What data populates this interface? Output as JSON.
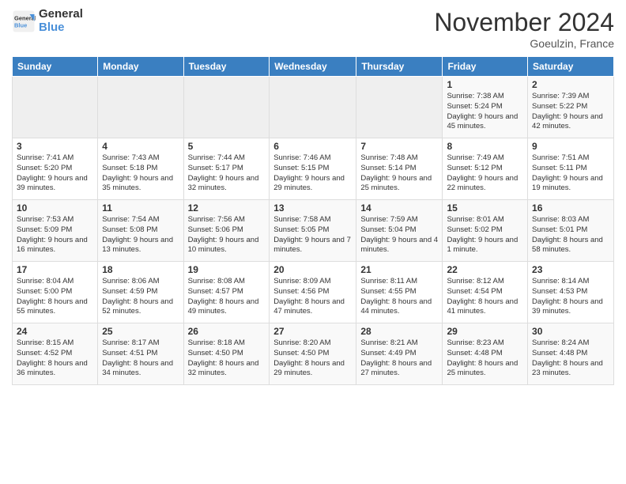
{
  "header": {
    "logo_line1": "General",
    "logo_line2": "Blue",
    "month": "November 2024",
    "location": "Goeulzin, France"
  },
  "days_of_week": [
    "Sunday",
    "Monday",
    "Tuesday",
    "Wednesday",
    "Thursday",
    "Friday",
    "Saturday"
  ],
  "weeks": [
    [
      {
        "day": "",
        "empty": true
      },
      {
        "day": "",
        "empty": true
      },
      {
        "day": "",
        "empty": true
      },
      {
        "day": "",
        "empty": true
      },
      {
        "day": "",
        "empty": true
      },
      {
        "day": "1",
        "sunrise": "Sunrise: 7:38 AM",
        "sunset": "Sunset: 5:24 PM",
        "daylight": "Daylight: 9 hours and 45 minutes."
      },
      {
        "day": "2",
        "sunrise": "Sunrise: 7:39 AM",
        "sunset": "Sunset: 5:22 PM",
        "daylight": "Daylight: 9 hours and 42 minutes."
      }
    ],
    [
      {
        "day": "3",
        "sunrise": "Sunrise: 7:41 AM",
        "sunset": "Sunset: 5:20 PM",
        "daylight": "Daylight: 9 hours and 39 minutes."
      },
      {
        "day": "4",
        "sunrise": "Sunrise: 7:43 AM",
        "sunset": "Sunset: 5:18 PM",
        "daylight": "Daylight: 9 hours and 35 minutes."
      },
      {
        "day": "5",
        "sunrise": "Sunrise: 7:44 AM",
        "sunset": "Sunset: 5:17 PM",
        "daylight": "Daylight: 9 hours and 32 minutes."
      },
      {
        "day": "6",
        "sunrise": "Sunrise: 7:46 AM",
        "sunset": "Sunset: 5:15 PM",
        "daylight": "Daylight: 9 hours and 29 minutes."
      },
      {
        "day": "7",
        "sunrise": "Sunrise: 7:48 AM",
        "sunset": "Sunset: 5:14 PM",
        "daylight": "Daylight: 9 hours and 25 minutes."
      },
      {
        "day": "8",
        "sunrise": "Sunrise: 7:49 AM",
        "sunset": "Sunset: 5:12 PM",
        "daylight": "Daylight: 9 hours and 22 minutes."
      },
      {
        "day": "9",
        "sunrise": "Sunrise: 7:51 AM",
        "sunset": "Sunset: 5:11 PM",
        "daylight": "Daylight: 9 hours and 19 minutes."
      }
    ],
    [
      {
        "day": "10",
        "sunrise": "Sunrise: 7:53 AM",
        "sunset": "Sunset: 5:09 PM",
        "daylight": "Daylight: 9 hours and 16 minutes."
      },
      {
        "day": "11",
        "sunrise": "Sunrise: 7:54 AM",
        "sunset": "Sunset: 5:08 PM",
        "daylight": "Daylight: 9 hours and 13 minutes."
      },
      {
        "day": "12",
        "sunrise": "Sunrise: 7:56 AM",
        "sunset": "Sunset: 5:06 PM",
        "daylight": "Daylight: 9 hours and 10 minutes."
      },
      {
        "day": "13",
        "sunrise": "Sunrise: 7:58 AM",
        "sunset": "Sunset: 5:05 PM",
        "daylight": "Daylight: 9 hours and 7 minutes."
      },
      {
        "day": "14",
        "sunrise": "Sunrise: 7:59 AM",
        "sunset": "Sunset: 5:04 PM",
        "daylight": "Daylight: 9 hours and 4 minutes."
      },
      {
        "day": "15",
        "sunrise": "Sunrise: 8:01 AM",
        "sunset": "Sunset: 5:02 PM",
        "daylight": "Daylight: 9 hours and 1 minute."
      },
      {
        "day": "16",
        "sunrise": "Sunrise: 8:03 AM",
        "sunset": "Sunset: 5:01 PM",
        "daylight": "Daylight: 8 hours and 58 minutes."
      }
    ],
    [
      {
        "day": "17",
        "sunrise": "Sunrise: 8:04 AM",
        "sunset": "Sunset: 5:00 PM",
        "daylight": "Daylight: 8 hours and 55 minutes."
      },
      {
        "day": "18",
        "sunrise": "Sunrise: 8:06 AM",
        "sunset": "Sunset: 4:59 PM",
        "daylight": "Daylight: 8 hours and 52 minutes."
      },
      {
        "day": "19",
        "sunrise": "Sunrise: 8:08 AM",
        "sunset": "Sunset: 4:57 PM",
        "daylight": "Daylight: 8 hours and 49 minutes."
      },
      {
        "day": "20",
        "sunrise": "Sunrise: 8:09 AM",
        "sunset": "Sunset: 4:56 PM",
        "daylight": "Daylight: 8 hours and 47 minutes."
      },
      {
        "day": "21",
        "sunrise": "Sunrise: 8:11 AM",
        "sunset": "Sunset: 4:55 PM",
        "daylight": "Daylight: 8 hours and 44 minutes."
      },
      {
        "day": "22",
        "sunrise": "Sunrise: 8:12 AM",
        "sunset": "Sunset: 4:54 PM",
        "daylight": "Daylight: 8 hours and 41 minutes."
      },
      {
        "day": "23",
        "sunrise": "Sunrise: 8:14 AM",
        "sunset": "Sunset: 4:53 PM",
        "daylight": "Daylight: 8 hours and 39 minutes."
      }
    ],
    [
      {
        "day": "24",
        "sunrise": "Sunrise: 8:15 AM",
        "sunset": "Sunset: 4:52 PM",
        "daylight": "Daylight: 8 hours and 36 minutes."
      },
      {
        "day": "25",
        "sunrise": "Sunrise: 8:17 AM",
        "sunset": "Sunset: 4:51 PM",
        "daylight": "Daylight: 8 hours and 34 minutes."
      },
      {
        "day": "26",
        "sunrise": "Sunrise: 8:18 AM",
        "sunset": "Sunset: 4:50 PM",
        "daylight": "Daylight: 8 hours and 32 minutes."
      },
      {
        "day": "27",
        "sunrise": "Sunrise: 8:20 AM",
        "sunset": "Sunset: 4:50 PM",
        "daylight": "Daylight: 8 hours and 29 minutes."
      },
      {
        "day": "28",
        "sunrise": "Sunrise: 8:21 AM",
        "sunset": "Sunset: 4:49 PM",
        "daylight": "Daylight: 8 hours and 27 minutes."
      },
      {
        "day": "29",
        "sunrise": "Sunrise: 8:23 AM",
        "sunset": "Sunset: 4:48 PM",
        "daylight": "Daylight: 8 hours and 25 minutes."
      },
      {
        "day": "30",
        "sunrise": "Sunrise: 8:24 AM",
        "sunset": "Sunset: 4:48 PM",
        "daylight": "Daylight: 8 hours and 23 minutes."
      }
    ]
  ]
}
